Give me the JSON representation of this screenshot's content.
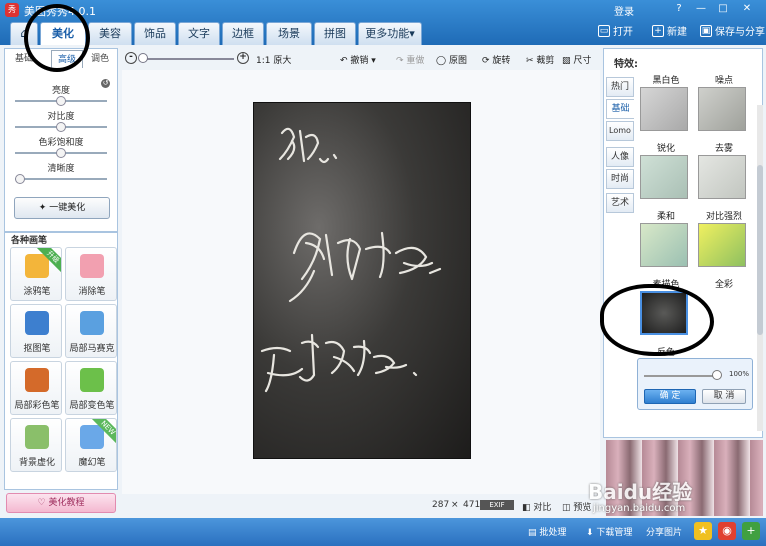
{
  "app": {
    "title": "美图秀秀4.0.1",
    "logo_text": "秀",
    "login": "登录",
    "window_controls": [
      "?",
      "—",
      "□",
      "✕"
    ]
  },
  "tabs": [
    {
      "label": "⌂"
    },
    {
      "label": "美化"
    },
    {
      "label": "美容"
    },
    {
      "label": "饰品"
    },
    {
      "label": "文字"
    },
    {
      "label": "边框"
    },
    {
      "label": "场景"
    },
    {
      "label": "拼图"
    },
    {
      "label": "更多功能▾"
    }
  ],
  "top_actions": {
    "open": "打开",
    "new": "新建",
    "save_share": "保存与分享"
  },
  "left_panel": {
    "subtabs": [
      "基础",
      "高级",
      "调色"
    ],
    "sliders": [
      {
        "label": "亮度",
        "value": 0.5
      },
      {
        "label": "对比度",
        "value": 0.5
      },
      {
        "label": "色彩饱和度",
        "value": 0.5
      },
      {
        "label": "清晰度",
        "value": 0.0
      }
    ],
    "one_key": "一键美化"
  },
  "brushes": {
    "header": "各种画笔",
    "items": [
      {
        "label": "涂鸦笔",
        "badge": "升级",
        "color": "#f3b53a"
      },
      {
        "label": "消除笔",
        "badge": "",
        "color": "#f2a0b0"
      },
      {
        "label": "抠图笔",
        "badge": "",
        "color": "#3d7fcf"
      },
      {
        "label": "局部马赛克",
        "badge": "",
        "color": "#5aa0e0"
      },
      {
        "label": "局部彩色笔",
        "badge": "",
        "color": "#d46a2a"
      },
      {
        "label": "局部变色笔",
        "badge": "",
        "color": "#6cc04a"
      },
      {
        "label": "背景虚化",
        "badge": "",
        "color": "#8abf6a"
      },
      {
        "label": "魔幻笔",
        "badge": "NEW",
        "color": "#6aa8e8"
      }
    ]
  },
  "tutorial": "美化教程",
  "toolbar": {
    "zoom_out": "-",
    "zoom_in": "+",
    "zoom": 0.0,
    "original_size": "1:1 原大",
    "undo": "撤销 ▾",
    "redo": "重做",
    "original": "原图",
    "rotate": "旋转",
    "crop": "裁剪",
    "size": "尺寸"
  },
  "status": {
    "width": "287",
    "times": "×",
    "height": "471",
    "exif": "EXIF",
    "compare": "对比",
    "preview": "预览"
  },
  "right_panel": {
    "header": "特效:",
    "categories": [
      "热门",
      "基础",
      "Lomo",
      "人像",
      "时尚",
      "艺术"
    ],
    "active_category": "基础",
    "effects": [
      {
        "label": "黑白色"
      },
      {
        "label": "噪点"
      },
      {
        "label": "锐化"
      },
      {
        "label": "去雾"
      },
      {
        "label": "柔和"
      },
      {
        "label": "对比强烈"
      },
      {
        "label": "素描色"
      },
      {
        "label": "全彩"
      },
      {
        "label": "反色"
      }
    ],
    "adjust": {
      "percent": "100%",
      "value": 1.0,
      "ok": "确 定",
      "cancel": "取 消"
    }
  },
  "bottom_bar": {
    "batch": "批处理",
    "download": "下载管理",
    "share_pic": "分享图片"
  },
  "watermark": {
    "line1": "Baidu经验",
    "line2": "jingyan.baidu.com"
  },
  "photo_text": [
    "在见：",
    "身体健康",
    "万事如意"
  ],
  "colors": {
    "accent": "#1f6bb6",
    "bottom": "#2a70bf",
    "ok": "#2f7fd0"
  }
}
